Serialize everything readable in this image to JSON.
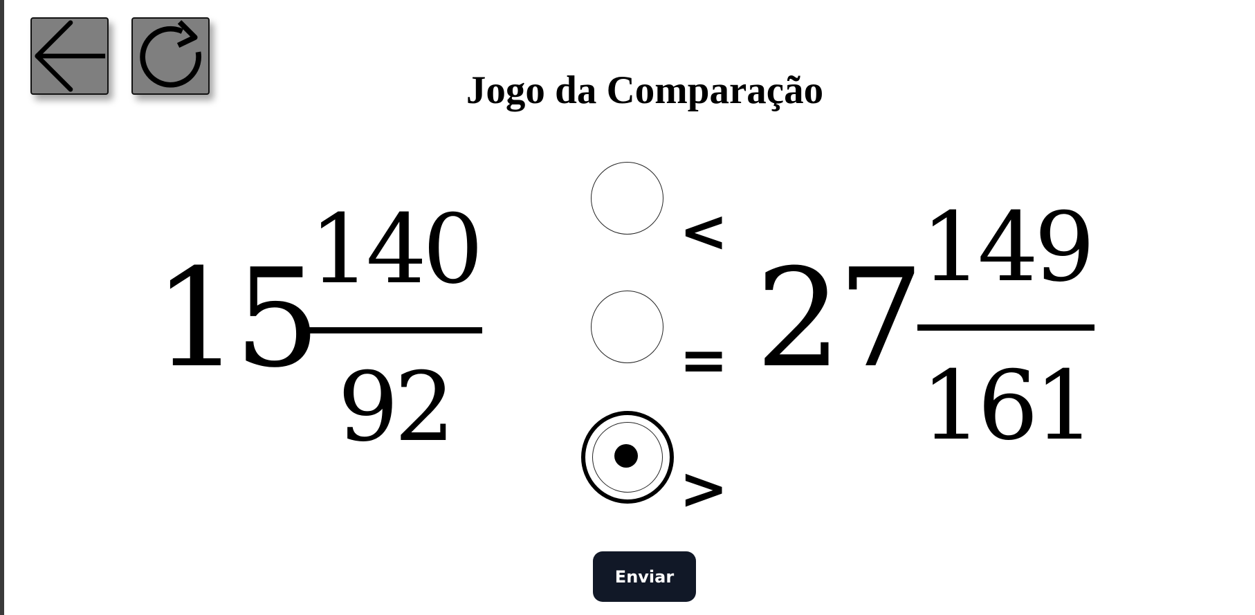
{
  "header": {
    "title": "Jogo da Comparação",
    "back_icon": "arrow-left-icon",
    "reload_icon": "reload-icon"
  },
  "comparison": {
    "left": {
      "whole": "15",
      "numerator": "140",
      "denominator": "92"
    },
    "right": {
      "whole": "27",
      "numerator": "149",
      "denominator": "161"
    },
    "options": [
      {
        "symbol": "<",
        "selected": false
      },
      {
        "symbol": "=",
        "selected": false
      },
      {
        "symbol": ">",
        "selected": true
      }
    ]
  },
  "actions": {
    "submit_label": "Enviar"
  },
  "colors": {
    "icon_button_bg": "#7f7f7f",
    "submit_bg": "#111827",
    "submit_text": "#ffffff"
  }
}
